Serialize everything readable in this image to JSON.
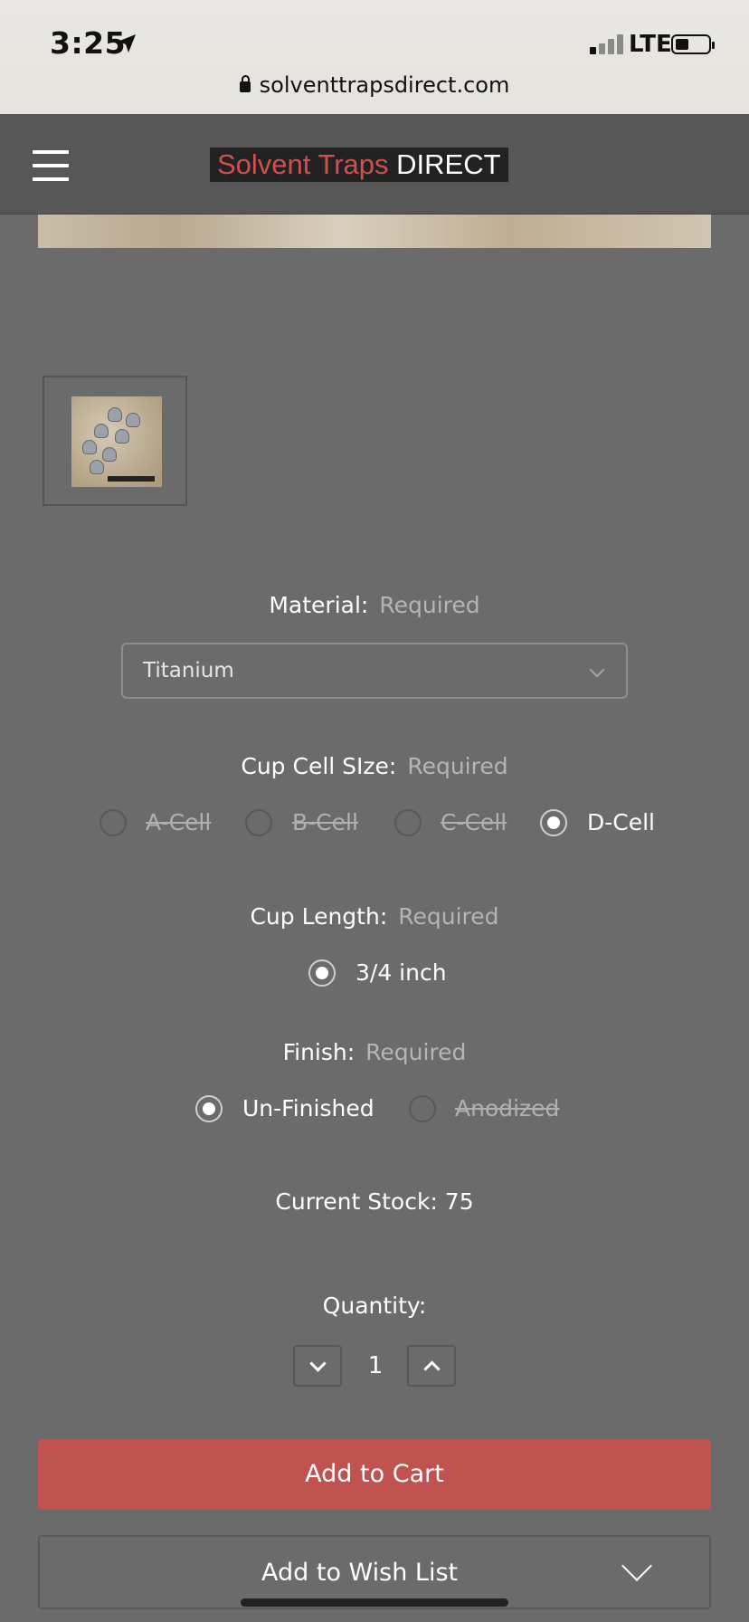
{
  "status_bar": {
    "time": "3:25",
    "network": "LTE",
    "url": "solventtrapsdirect.com"
  },
  "header": {
    "logo_part1": "Solvent Traps",
    "logo_part2": "DIRECT"
  },
  "product_options": {
    "material": {
      "label": "Material:",
      "required": "Required",
      "selected": "Titanium"
    },
    "cup_cell_size": {
      "label": "Cup Cell SIze:",
      "required": "Required",
      "options": [
        {
          "label": "A-Cell",
          "checked": false,
          "disabled": true
        },
        {
          "label": "B-Cell",
          "checked": false,
          "disabled": true
        },
        {
          "label": "C-Cell",
          "checked": false,
          "disabled": true
        },
        {
          "label": "D-Cell",
          "checked": true,
          "disabled": false
        }
      ]
    },
    "cup_length": {
      "label": "Cup Length:",
      "required": "Required",
      "options": [
        {
          "label": "3/4 inch",
          "checked": true,
          "disabled": false
        }
      ]
    },
    "finish": {
      "label": "Finish:",
      "required": "Required",
      "options": [
        {
          "label": "Un-Finished",
          "checked": true,
          "disabled": false
        },
        {
          "label": "Anodized",
          "checked": false,
          "disabled": true
        }
      ]
    }
  },
  "stock": {
    "text": "Current Stock: 75"
  },
  "quantity": {
    "label": "Quantity:",
    "value": "1"
  },
  "actions": {
    "add_to_cart": "Add to Cart",
    "add_to_wishlist": "Add to Wish List"
  },
  "colors": {
    "page_bg": "#6b6b6b",
    "header_bg": "#575757",
    "accent_red": "#c0524f",
    "logo_red": "#d0504f"
  }
}
